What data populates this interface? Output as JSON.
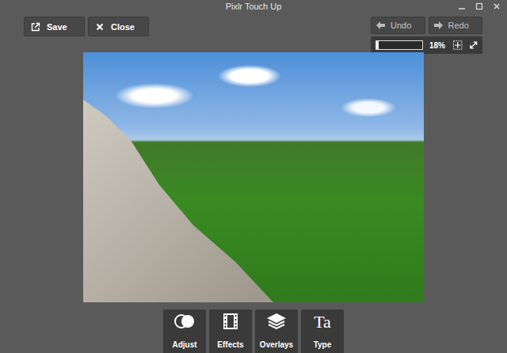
{
  "window": {
    "title": "Pixlr Touch Up"
  },
  "actions": [
    {
      "label": "Save"
    },
    {
      "label": "Close"
    }
  ],
  "history": [
    {
      "label": "Undo"
    },
    {
      "label": "Redo"
    }
  ],
  "zoom": {
    "level": 0.06,
    "reading": "18%"
  },
  "tools": [
    {
      "label": "Adjust",
      "kind": "adjust"
    },
    {
      "label": "Effects",
      "kind": "effects"
    },
    {
      "label": "Overlays",
      "kind": "overlays"
    },
    {
      "label": "Type",
      "kind": "type",
      "glyph": "Ta"
    }
  ]
}
